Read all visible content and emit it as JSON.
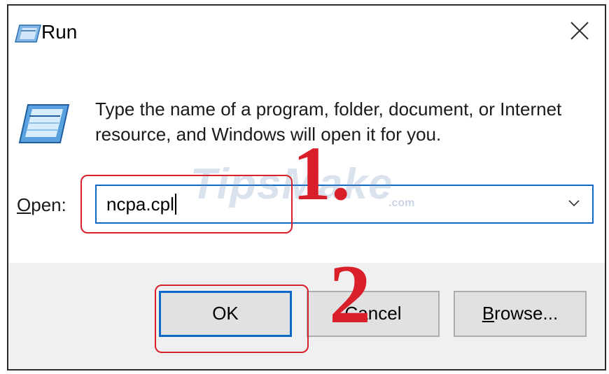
{
  "dialog": {
    "title": "Run",
    "description": "Type the name of a program, folder, document, or Internet resource, and Windows will open it for you.",
    "open_label_access_key": "O",
    "open_label_rest": "pen:",
    "open_value": "ncpa.cpl"
  },
  "buttons": {
    "ok": "OK",
    "cancel": "Cancel",
    "browse": "Browse..."
  },
  "annotations": {
    "step1": "1.",
    "step2": "2",
    "highlight_color": "#d9202a"
  },
  "watermark": {
    "text": "TipsMake",
    "suffix": ".com"
  },
  "icons": [
    "run-icon",
    "close-icon",
    "chevron-down-icon"
  ],
  "colors": {
    "accent": "#0a68c8",
    "footer_bg": "#f0f0f0"
  }
}
